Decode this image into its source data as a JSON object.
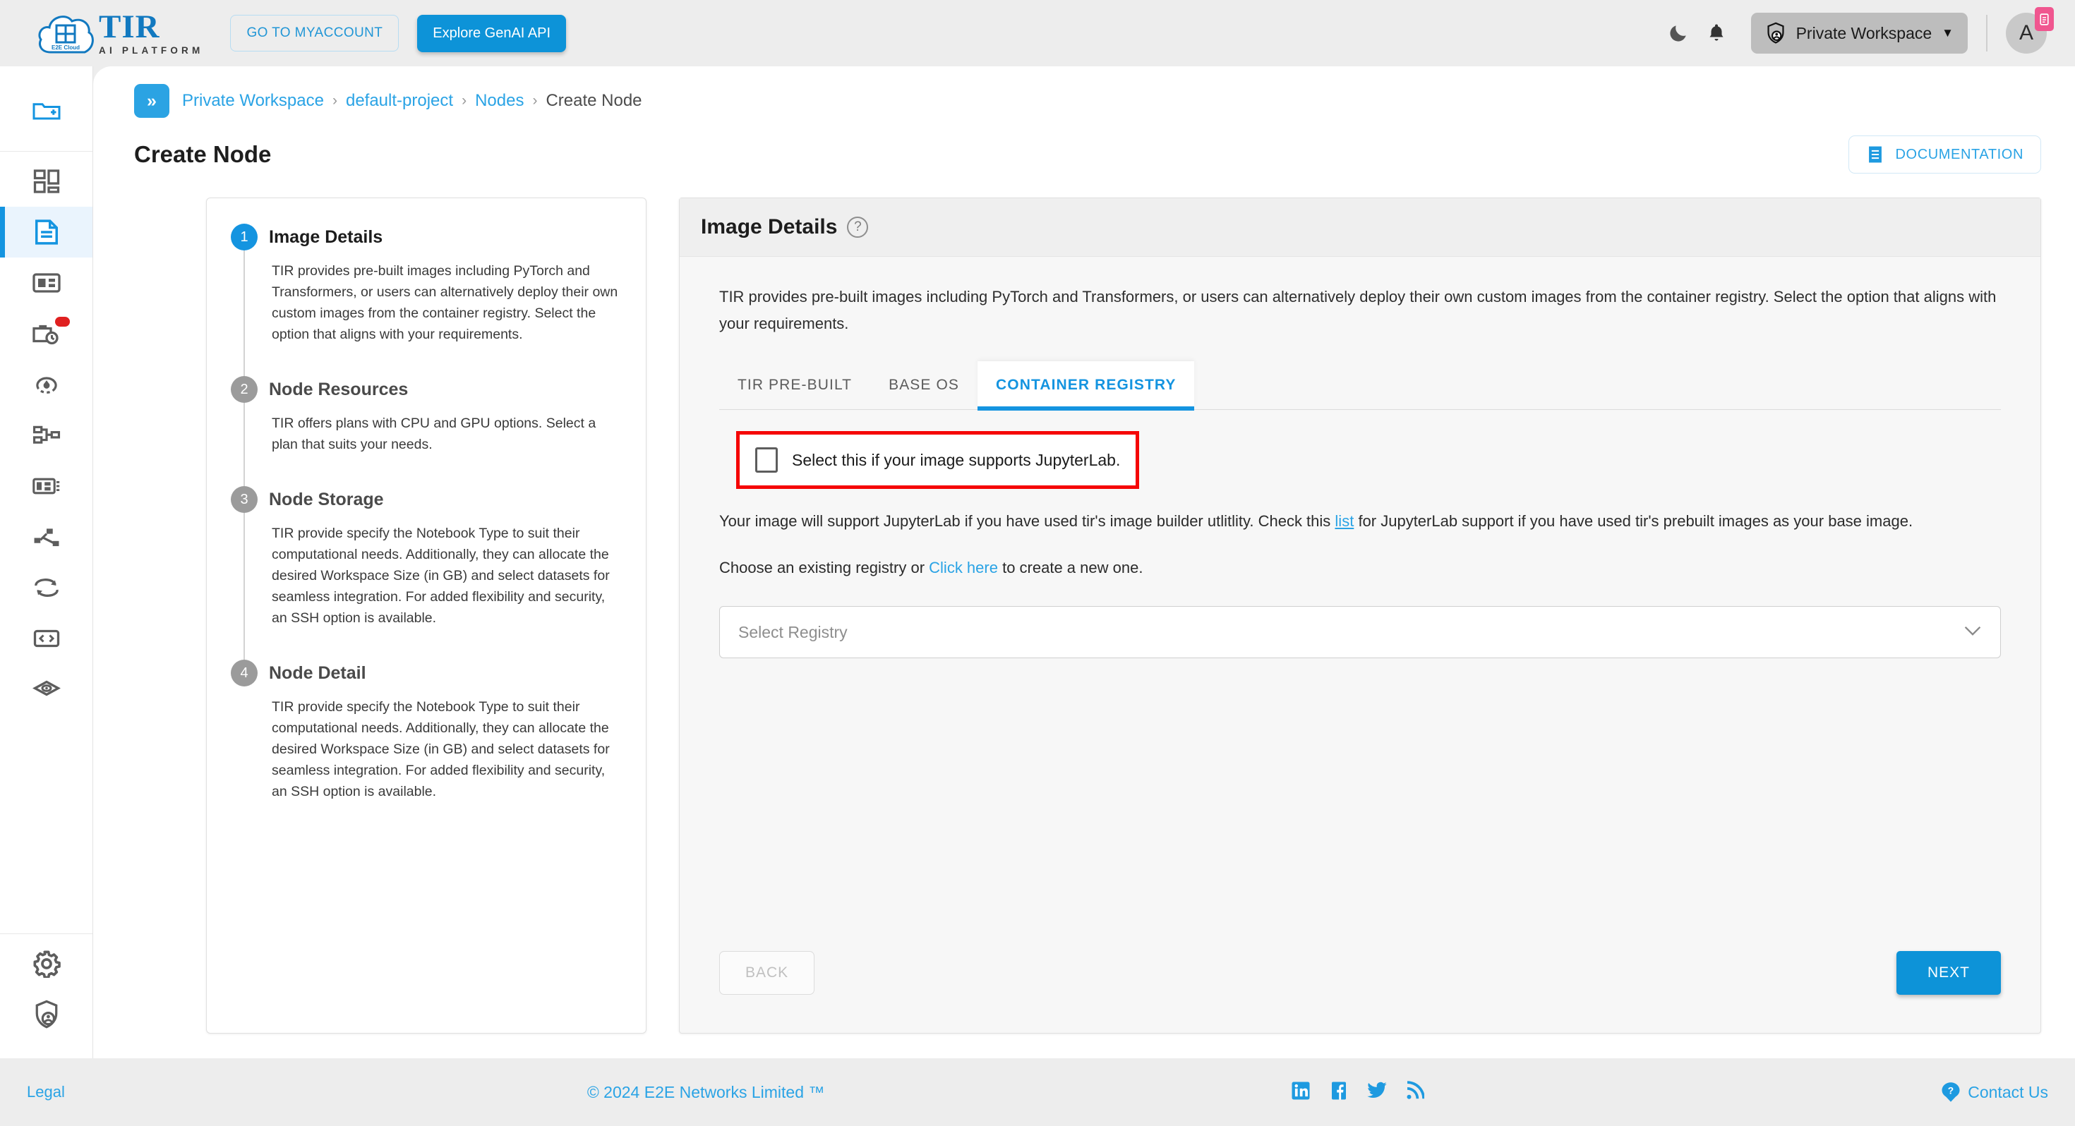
{
  "header": {
    "logo_title": "TIR",
    "logo_subtitle": "AI PLATFORM",
    "logo_cloud_label": "E2E Cloud",
    "myaccount_button": "GO TO MYACCOUNT",
    "genai_button": "Explore GenAI API",
    "dark_mode_icon": "moon-icon",
    "notifications_icon": "bell-icon",
    "workspace_label": "Private Workspace",
    "workspace_icon": "shield-user-icon",
    "workspace_caret": "▼",
    "avatar_initial": "A",
    "avatar_badge_icon": "clipboard-icon"
  },
  "rail": {
    "items": [
      {
        "name": "new-folder",
        "icon": "folder-plus-icon",
        "active": false,
        "badge": false
      },
      {
        "name": "dashboard",
        "icon": "grid-dashboard-icon",
        "active": false,
        "badge": false
      },
      {
        "name": "nodes",
        "icon": "document-icon",
        "active": true,
        "badge": false
      },
      {
        "name": "datasets",
        "icon": "card-list-icon",
        "active": false,
        "badge": false
      },
      {
        "name": "jobs",
        "icon": "briefcase-clock-icon",
        "active": false,
        "badge": true
      },
      {
        "name": "inference",
        "icon": "deploy-cycle-icon",
        "active": false,
        "badge": false
      },
      {
        "name": "pipelines",
        "icon": "sitemap-icon",
        "active": false,
        "badge": false
      },
      {
        "name": "models",
        "icon": "server-card-icon",
        "active": false,
        "badge": false
      },
      {
        "name": "share",
        "icon": "share-nodes-icon",
        "active": false,
        "badge": false
      },
      {
        "name": "sync",
        "icon": "sync-arrows-icon",
        "active": false,
        "badge": false
      },
      {
        "name": "api",
        "icon": "code-box-icon",
        "active": false,
        "badge": false
      },
      {
        "name": "containers",
        "icon": "cube-eye-icon",
        "active": false,
        "badge": false
      }
    ],
    "bottom_items": [
      {
        "name": "settings",
        "icon": "gear-icon"
      },
      {
        "name": "security",
        "icon": "shield-user-icon"
      }
    ]
  },
  "breadcrumb": {
    "toggle_icon": "»",
    "items": [
      {
        "label": "Private Workspace",
        "current": false
      },
      {
        "label": "default-project",
        "current": false
      },
      {
        "label": "Nodes",
        "current": false
      },
      {
        "label": "Create Node",
        "current": true
      }
    ],
    "separator": "›"
  },
  "page": {
    "title": "Create Node",
    "documentation_button": "DOCUMENTATION",
    "documentation_icon": "document-lines-icon"
  },
  "stepper": {
    "steps": [
      {
        "number": "1",
        "title": "Image Details",
        "active": true,
        "description": "TIR provides pre-built images including PyTorch and Transformers, or users can alternatively deploy their own custom images from the container registry. Select the option that aligns with your requirements."
      },
      {
        "number": "2",
        "title": "Node Resources",
        "active": false,
        "description": "TIR offers plans with CPU and GPU options. Select a plan that suits your needs."
      },
      {
        "number": "3",
        "title": "Node Storage",
        "active": false,
        "description": "TIR provide specify the Notebook Type to suit their computational needs. Additionally, they can allocate the desired Workspace Size (in GB) and select datasets for seamless integration. For added flexibility and security, an SSH option is available."
      },
      {
        "number": "4",
        "title": "Node Detail",
        "active": false,
        "description": "TIR provide specify the Notebook Type to suit their computational needs. Additionally, they can allocate the desired Workspace Size (in GB) and select datasets for seamless integration. For added flexibility and security, an SSH option is available."
      }
    ]
  },
  "main": {
    "card_title": "Image Details",
    "help_icon": "?",
    "intro": "TIR provides pre-built images including PyTorch and Transformers, or users can alternatively deploy their own custom images from the container registry. Select the option that aligns with your requirements.",
    "tabs": [
      {
        "label": "TIR PRE-BUILT",
        "active": false
      },
      {
        "label": "BASE OS",
        "active": false
      },
      {
        "label": "CONTAINER REGISTRY",
        "active": true
      }
    ],
    "jupyterlab_checkbox": {
      "label": "Select this if your image supports JupyterLab.",
      "checked": false,
      "highlight_color": "#f50505"
    },
    "support_note_part1": "Your image will support JupyterLab if you have used tir's image builder utlitlity. Check this",
    "support_note_link": "list",
    "support_note_part2": "for JupyterLab support if you have used tir's prebuilt images as your base image.",
    "registry_prompt_part1": "Choose an existing registry or",
    "registry_prompt_link": "Click here",
    "registry_prompt_part2": "to create a new one.",
    "registry_select_placeholder": "Select Registry",
    "registry_caret_icon": "chevron-down-icon",
    "back_button": "BACK",
    "next_button": "NEXT"
  },
  "footer": {
    "legal": "Legal",
    "copyright": "© 2024 E2E Networks Limited ™",
    "social": [
      {
        "name": "linkedin",
        "icon": "linkedin-icon"
      },
      {
        "name": "facebook",
        "icon": "facebook-icon"
      },
      {
        "name": "twitter",
        "icon": "twitter-icon"
      },
      {
        "name": "rss",
        "icon": "rss-icon"
      }
    ],
    "contact": "Contact Us",
    "contact_icon": "question-balloon-icon"
  },
  "colors": {
    "accent": "#1494e0",
    "link": "#2aa3e5",
    "highlight": "#f50505",
    "badge": "#e02020",
    "avatar_badge": "#f0568f"
  }
}
